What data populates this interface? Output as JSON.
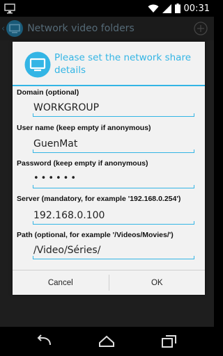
{
  "status_bar": {
    "time": "00:31"
  },
  "action_bar": {
    "title": "Network video folders"
  },
  "dialog": {
    "title": "Please set the network share details",
    "fields": [
      {
        "label": "Domain (optional)",
        "value": "WORKGROUP"
      },
      {
        "label": "User name (keep empty if anonymous)",
        "value": "GuenMat"
      },
      {
        "label": "Password (keep empty if anonymous)",
        "value": "••••••"
      },
      {
        "label": "Server (mandatory, for example '192.168.0.254')",
        "value": "192.168.0.100"
      },
      {
        "label": "Path (optional, for example '/Videos/Movies/')",
        "value": "/Video/Séries/"
      }
    ],
    "cancel_label": "Cancel",
    "ok_label": "OK"
  },
  "colors": {
    "accent": "#33b5e5",
    "dialog_bg": "#f2f2f2",
    "dim_bg": "#1e1e1e"
  },
  "icons": [
    "monitor-icon",
    "wifi-icon",
    "signal-icon",
    "battery-icon",
    "add-icon",
    "back-icon",
    "home-icon",
    "recents-icon"
  ]
}
